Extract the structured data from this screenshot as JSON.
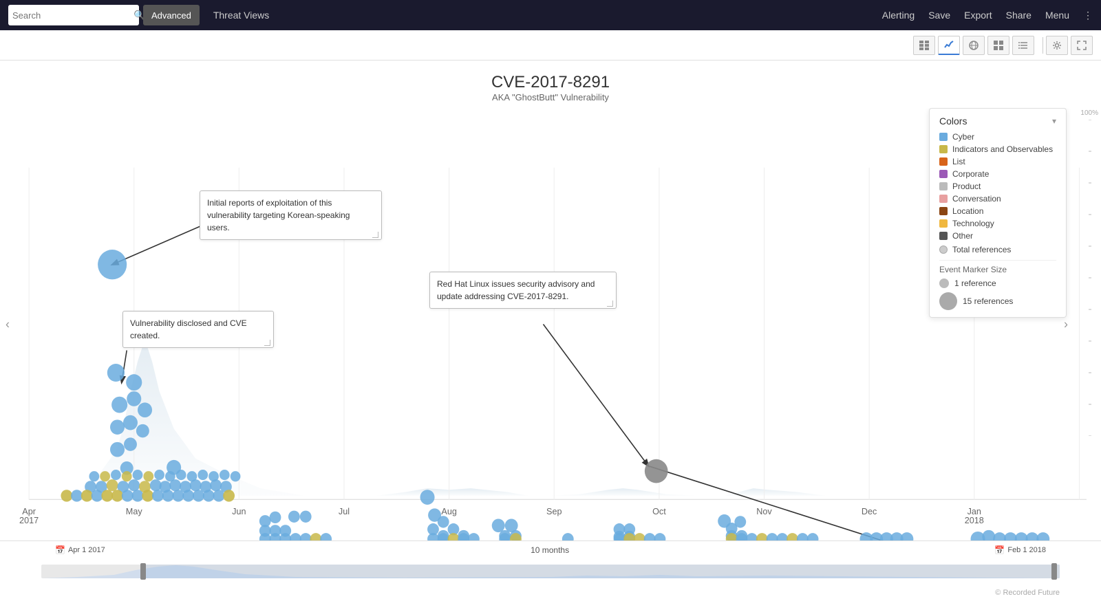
{
  "nav": {
    "search_placeholder": "Search",
    "advanced_label": "Advanced",
    "threat_views_label": "Threat Views",
    "alerting_label": "Alerting",
    "save_label": "Save",
    "export_label": "Export",
    "share_label": "Share",
    "menu_label": "Menu"
  },
  "chart": {
    "title": "CVE-2017-8291",
    "subtitle": "AKA \"GhostButt\" Vulnerability"
  },
  "annotations": [
    {
      "id": "ann1",
      "text": "Initial reports of exploitation of this vulnerability targeting Korean-speaking users.",
      "top": "120",
      "left": "285",
      "width": "265"
    },
    {
      "id": "ann2",
      "text": "Vulnerability disclosed and CVE created.",
      "top": "295",
      "left": "175",
      "width": "220"
    },
    {
      "id": "ann3",
      "text": "Red Hat Linux issues security advisory and update addressing CVE-2017-8291.",
      "top": "240",
      "left": "620",
      "width": "270"
    }
  ],
  "colors_legend": {
    "title": "Colors",
    "items": [
      {
        "name": "Cyber",
        "color": "#6aabde"
      },
      {
        "name": "Indicators and Observables",
        "color": "#c8b84a"
      },
      {
        "name": "List",
        "color": "#d8641a"
      },
      {
        "name": "Corporate",
        "color": "#9b59b6"
      },
      {
        "name": "Product",
        "color": "#bbb"
      },
      {
        "name": "Conversation",
        "color": "#e8a0a0"
      },
      {
        "name": "Location",
        "color": "#8b4513"
      },
      {
        "name": "Technology",
        "color": "#f0b840"
      },
      {
        "name": "Other",
        "color": "#555"
      }
    ],
    "total_references": "Total references",
    "event_marker_size": "Event Marker Size",
    "size_items": [
      {
        "label": "1 reference",
        "size": "small"
      },
      {
        "label": "15 references",
        "size": "large"
      }
    ]
  },
  "x_axis": {
    "labels": [
      {
        "text": "Apr\n2017",
        "pos": "3"
      },
      {
        "text": "May",
        "pos": "13"
      },
      {
        "text": "Jun",
        "pos": "23"
      },
      {
        "text": "Jul",
        "pos": "33"
      },
      {
        "text": "Aug",
        "pos": "43"
      },
      {
        "text": "Sep",
        "pos": "53"
      },
      {
        "text": "Oct",
        "pos": "63"
      },
      {
        "text": "Nov",
        "pos": "73"
      },
      {
        "text": "Dec",
        "pos": "83"
      },
      {
        "text": "Jan\n2018",
        "pos": "93"
      }
    ]
  },
  "timeline": {
    "start_date": "Apr 1 2017",
    "end_date": "Feb 1 2018",
    "duration": "10 months"
  },
  "copyright": "© Recorded Future",
  "percent_label": "100%"
}
